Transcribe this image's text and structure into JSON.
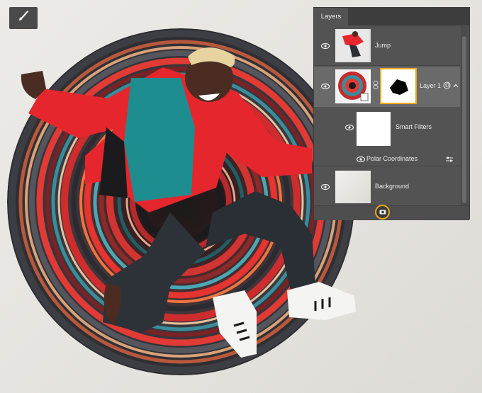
{
  "tool": {
    "icon": "brush-icon"
  },
  "layers_panel": {
    "tab_label": "Layers",
    "layers": [
      {
        "name": "Jump",
        "visible": true
      },
      {
        "name": "Layer 1",
        "visible": true,
        "selected": true,
        "has_mask": true
      },
      {
        "name": "Smart Filters",
        "visible": true
      },
      {
        "name": "Polar Coordinates",
        "visible": true
      },
      {
        "name": "Background",
        "visible": true
      }
    ],
    "footer_icon": "camera-icon",
    "highlight_color": "#f0a81c"
  },
  "colors": {
    "panel_bg": "#535353",
    "selected_row": "#6a6a6a",
    "jacket_red": "#e5262d",
    "shirt_teal": "#1e8d8f"
  }
}
